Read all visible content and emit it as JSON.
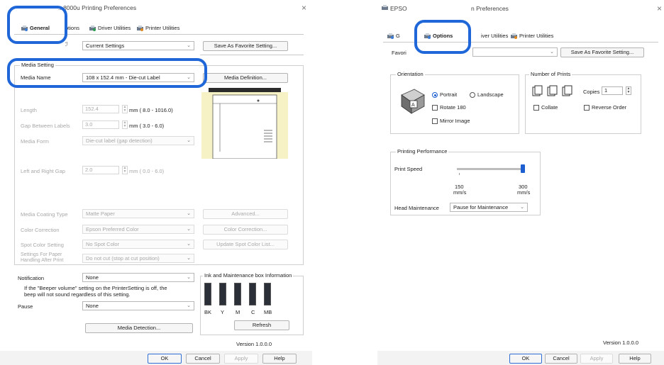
{
  "left_window": {
    "title": "...8000u Printing Preferences",
    "close_glyph": "×",
    "tabs": [
      {
        "label": "General",
        "icon": "printer-settings-icon"
      },
      {
        "label": "ptions"
      },
      {
        "label": "Driver Utilities",
        "icon": "driver-utilities-icon"
      },
      {
        "label": "Printer Utilities",
        "icon": "printer-utilities-icon"
      }
    ],
    "favorite": {
      "value": "Current Settings",
      "button": "Save As Favorite Setting..."
    },
    "media_setting": {
      "legend": "Media Setting",
      "media_name_label": "Media Name",
      "media_name_value": "108 x 152.4 mm - Die-cut Label",
      "media_definition_button": "Media Definition...",
      "length_label": "Length",
      "length_value": "152.4",
      "length_range": "mm ( 8.0 - 1016.0)",
      "gap_label": "Gap Between Labels",
      "gap_value": "3.0",
      "gap_range": "mm ( 3.0 - 6.0)",
      "media_form_label": "Media Form",
      "media_form_value": "Die-cut label (gap detection)",
      "lr_gap_label": "Left and Right Gap",
      "lr_gap_value": "2.0",
      "lr_gap_range": "mm ( 0.0 - 6.0)",
      "coating_label": "Media Coating Type",
      "coating_value": "Matte Paper",
      "advanced_button": "Advanced...",
      "color_correction_label": "Color Correction",
      "color_correction_value": "Epson Preferred Color",
      "color_correction_button": "Color Correction...",
      "spot_label": "Spot Color Setting",
      "spot_value": "No Spot Color",
      "spot_button": "Update Spot Color List...",
      "handling_label_1": "Settings For Paper",
      "handling_label_2": "Handling After Print",
      "handling_value": "Do not cut (stop at cut position)"
    },
    "notification_label": "Notification",
    "notification_value": "None",
    "beeper_note_1": "If the \"Beeper volume\" setting on the PrinterSetting is off, the",
    "beeper_note_2": "beep will not sound regardless of this setting.",
    "pause_label": "Pause",
    "pause_value": "None",
    "media_detection_button": "Media Detection...",
    "ink_legend": "Ink and Maintenance box Information",
    "ink_labels": [
      "BK",
      "Y",
      "M",
      "C",
      "MB"
    ],
    "refresh_button": "Refresh",
    "version": "Version 1.0.0.0",
    "ok": "OK",
    "cancel": "Cancel",
    "apply": "Apply",
    "help": "Help"
  },
  "right_window": {
    "title_left": "EPSO",
    "title_right": "n Preferences",
    "close_glyph": "×",
    "tabs": [
      {
        "label": "G"
      },
      {
        "label": "Options",
        "icon": "options-icon"
      },
      {
        "label": "iver Utilities"
      },
      {
        "label": "Printer Utilities",
        "icon": "printer-utilities-icon"
      }
    ],
    "favorite_label": "Favori",
    "favorite_button": "Save As Favorite Setting...",
    "orientation_legend": "Orientation",
    "portrait": "Portrait",
    "landscape": "Landscape",
    "rotate": "Rotate 180",
    "mirror": "Mirror Image",
    "prints_legend": "Number of Prints",
    "copies_label": "Copies",
    "copies_value": "1",
    "collate": "Collate",
    "reverse": "Reverse Order",
    "perf_legend": "Printing Performance",
    "speed_label": "Print Speed",
    "speed_min": "150",
    "speed_max": "300",
    "speed_unit": "mm/s",
    "speed_level": 1.0,
    "head_label": "Head Maintenance",
    "head_value": "Pause for Maintenance",
    "version": "Version 1.0.0.0",
    "ok": "OK",
    "cancel": "Cancel",
    "apply": "Apply",
    "help": "Help"
  },
  "colors": {
    "highlight": "#1f66d8",
    "accent": "#1d5fd1"
  }
}
